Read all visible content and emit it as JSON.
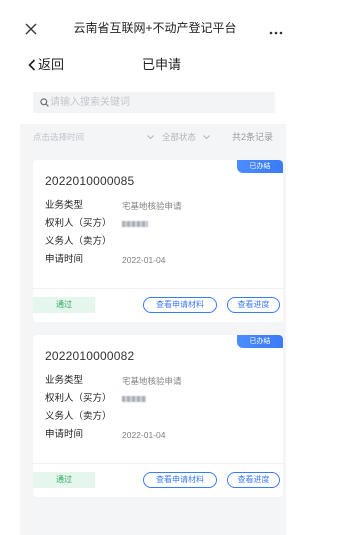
{
  "titlebar": {
    "close_icon": "close-icon",
    "title": "云南省互联网+不动产登记平台",
    "more_icon": "more-icon"
  },
  "nav": {
    "back_icon": "back-chevron-icon",
    "back_label": "返回",
    "page_title": "已申请"
  },
  "search": {
    "icon": "search-icon",
    "placeholder": "请输入搜索关键词"
  },
  "filters": {
    "time_placeholder": "点击选择时间",
    "time_icon": "chevron-down-icon",
    "status_selected": "全部状态",
    "status_icon": "chevron-down-icon",
    "record_count": "共2条记录"
  },
  "cards": [
    {
      "status_badge": "已办结",
      "application_no": "2022010000085",
      "fields": [
        {
          "label": "业务类型",
          "value": "宅基地核验申请"
        },
        {
          "label": "权利人（买方）",
          "value": ""
        },
        {
          "label": "义务人（卖方）",
          "value": ""
        },
        {
          "label": "申请时间",
          "value": "2022-01-04"
        }
      ],
      "result": "通过",
      "actions": {
        "materials": "查看申请材料",
        "progress": "查看进度"
      }
    },
    {
      "status_badge": "已办结",
      "application_no": "2022010000082",
      "fields": [
        {
          "label": "业务类型",
          "value": "宅基地核验申请"
        },
        {
          "label": "权利人（买方）",
          "value": ""
        },
        {
          "label": "义务人（卖方）",
          "value": ""
        },
        {
          "label": "申请时间",
          "value": "2022-01-04"
        }
      ],
      "result": "通过",
      "actions": {
        "materials": "查看申请材料",
        "progress": "查看进度"
      }
    }
  ],
  "colors": {
    "accent": "#3a7bf6",
    "success": "#2ea860",
    "success_bg": "#e5f6ec",
    "page_bg": "#f4f5f7",
    "card_bg": "#ffffff"
  }
}
